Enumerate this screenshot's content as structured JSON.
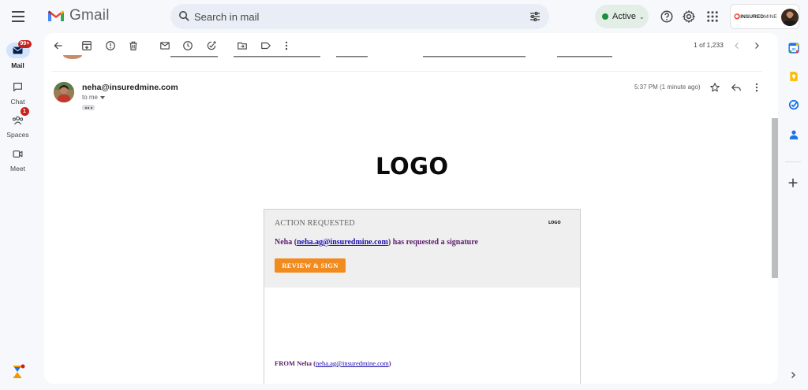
{
  "app": {
    "name": "Gmail"
  },
  "search": {
    "placeholder": "Search in mail"
  },
  "status": {
    "label": "Active",
    "color": "#1e8e3e"
  },
  "account": {
    "brand_prefix": "INSURED",
    "brand_suffix": "MINE"
  },
  "rail": {
    "items": [
      {
        "label": "Mail",
        "badge": "99+",
        "active": true,
        "icon": "mail-icon"
      },
      {
        "label": "Chat",
        "icon": "chat-icon"
      },
      {
        "label": "Spaces",
        "badge": "1",
        "icon": "spaces-icon"
      },
      {
        "label": "Meet",
        "icon": "meet-icon"
      }
    ]
  },
  "toolbar": {
    "pager": "1 of 1,233",
    "icons": [
      "back-icon",
      "archive-icon",
      "report-spam-icon",
      "delete-icon",
      "mark-unread-icon",
      "snooze-icon",
      "add-task-icon",
      "move-to-icon",
      "label-icon",
      "more-icon"
    ]
  },
  "message": {
    "sender": "neha@insuredmine.com",
    "to": "to me",
    "timestamp": "5:37 PM (1 minute ago)",
    "logo_text": "LOGO",
    "card": {
      "title": "ACTION REQUESTED",
      "mini_logo": "LOGO",
      "requester_name": "Neha (",
      "requester_email": "neha.ag@insuredmine.com",
      "request_suffix": ") has requested a signature",
      "button_label": "REVIEW & SIGN",
      "from_prefix": "FROM Neha (",
      "from_email": "neha.ag@insuredmine.com",
      "from_suffix": ")"
    }
  },
  "side_panel": {
    "apps": [
      "calendar-icon",
      "keep-icon",
      "tasks-icon",
      "contacts-icon"
    ]
  },
  "colors": {
    "accent_button": "#f28b1e",
    "request_text": "#5b1f6a",
    "link": "#1a0dab",
    "badge": "#c5221f"
  }
}
